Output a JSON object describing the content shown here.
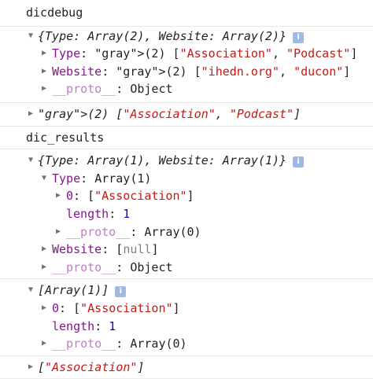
{
  "console": {
    "dicdebug_label": "dicdebug",
    "dicdebug_summary": "{Type: Array(2), Website: Array(2)}",
    "type_key": "Type",
    "website_key": "Website",
    "proto_key": "__proto__",
    "dicdebug_type_value": "(2) [\"Association\", \"Podcast\"]",
    "dicdebug_website_value": "(2) [\"ihedn.org\", \"ducon\"]",
    "object_word": "Object",
    "array_log": "(2) [\"Association\", \"Podcast\"]",
    "dic_results_label": "dic_results",
    "dic_results_summary": "{Type: Array(1), Website: Array(1)}",
    "dic_results_type_value": "Array(1)",
    "index0_key": "0",
    "index0_value": "[\"Association\"]",
    "length_key": "length",
    "length_value": "1",
    "array0_value": "Array(0)",
    "dic_results_website_value": "[null]",
    "array1_summary": "[Array(1)]",
    "array1_index0_value": "[\"Association\"]",
    "final_log": "[\"Association\"]",
    "info_glyph": "i"
  },
  "icons": {
    "expanded": "▼",
    "collapsed": "▶"
  }
}
